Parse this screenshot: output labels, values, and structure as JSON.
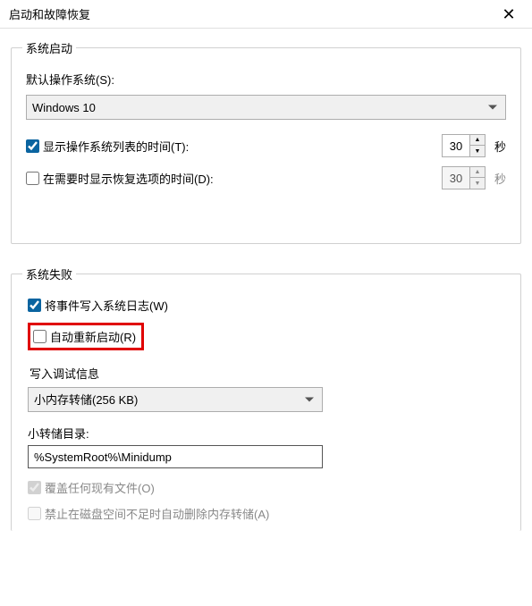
{
  "titlebar": {
    "title": "启动和故障恢复",
    "close": "✕"
  },
  "startup": {
    "legend": "系统启动",
    "defaultOsLabel": "默认操作系统(S):",
    "defaultOsValue": "Windows 10",
    "showOsListLabel": "显示操作系统列表的时间(T):",
    "showOsListChecked": true,
    "showOsListSeconds": "30",
    "showRecoveryLabel": "在需要时显示恢复选项的时间(D):",
    "showRecoveryChecked": false,
    "showRecoverySeconds": "30",
    "secondsUnit": "秒"
  },
  "failure": {
    "legend": "系统失败",
    "writeEventLabel": "将事件写入系统日志(W)",
    "writeEventChecked": true,
    "autoRestartLabel": "自动重新启动(R)",
    "autoRestartChecked": false,
    "debugInfoLabel": "写入调试信息",
    "dumpTypeValue": "小内存转储(256 KB)",
    "dumpDirLabel": "小转储目录:",
    "dumpDirValue": "%SystemRoot%\\Minidump",
    "overwriteLabel": "覆盖任何现有文件(O)",
    "overwriteChecked": true,
    "disableOnLowDiskLabel": "禁止在磁盘空间不足时自动删除内存转储(A)",
    "disableOnLowDiskChecked": false
  }
}
